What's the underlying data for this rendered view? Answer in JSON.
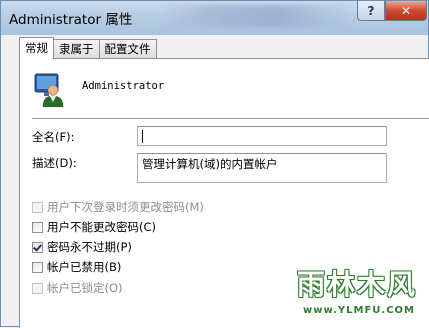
{
  "window": {
    "title": "Administrator 属性",
    "help_button": "?",
    "close_button": "✕"
  },
  "tabs": [
    {
      "label": "常规",
      "active": true
    },
    {
      "label": "隶属于",
      "active": false
    },
    {
      "label": "配置文件",
      "active": false
    }
  ],
  "user": {
    "name": "Administrator",
    "avatar_icon": "user-avatar-icon"
  },
  "fields": {
    "full_name_label": "全名(F):",
    "full_name_value": "",
    "description_label": "描述(D):",
    "description_value": "管理计算机(域)的内置帐户"
  },
  "options": [
    {
      "label": "用户下次登录时须更改密码(M)",
      "checked": false,
      "enabled": false
    },
    {
      "label": "用户不能更改密码(C)",
      "checked": false,
      "enabled": true
    },
    {
      "label": "密码永不过期(P)",
      "checked": true,
      "enabled": true
    },
    {
      "label": "帐户已禁用(B)",
      "checked": false,
      "enabled": true
    },
    {
      "label": "帐户已锁定(O)",
      "checked": false,
      "enabled": false
    }
  ],
  "watermark": {
    "main": "雨林木风",
    "sub": "www.YLMFU.COM"
  }
}
